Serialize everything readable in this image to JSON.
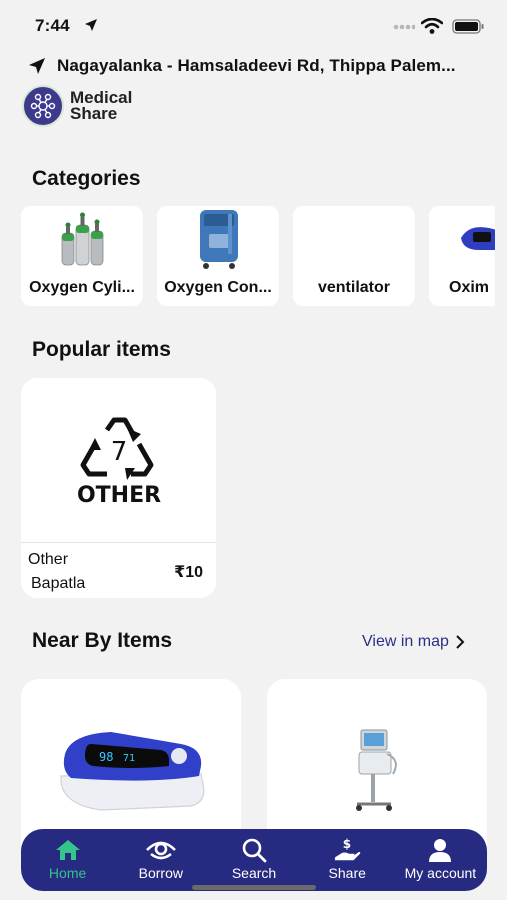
{
  "status": {
    "time": "7:44"
  },
  "header": {
    "address": "Nagayalanka - Hamsaladeevi Rd, Thippa Palem...",
    "logo_line1": "Medical",
    "logo_line2": "Share"
  },
  "categories": {
    "title": "Categories",
    "items": [
      {
        "label": "Oxygen Cyli...",
        "icon": "oxygen-cylinder-image"
      },
      {
        "label": "Oxygen Con...",
        "icon": "oxygen-concentrator-image"
      },
      {
        "label": "ventilator",
        "icon": ""
      },
      {
        "label": "Oxim",
        "icon": "oximeter-image"
      }
    ]
  },
  "popular": {
    "title": "Popular items",
    "items": [
      {
        "badge_number": "7",
        "badge_text": "OTHER",
        "name": "Other",
        "location": "Bapatla",
        "price": "₹10"
      }
    ]
  },
  "nearby": {
    "title": "Near By Items",
    "view_map": "View in map"
  },
  "tabs": [
    {
      "label": "Home",
      "icon": "home-icon",
      "active": true
    },
    {
      "label": "Borrow",
      "icon": "eye-icon",
      "active": false
    },
    {
      "label": "Search",
      "icon": "search-icon",
      "active": false
    },
    {
      "label": "Share",
      "icon": "share-hand-dollar-icon",
      "active": false
    },
    {
      "label": "My account",
      "icon": "user-icon",
      "active": false
    }
  ],
  "colors": {
    "accent_navy": "#262a80",
    "active_tab": "#35c48a",
    "background": "#f2f2f3"
  }
}
